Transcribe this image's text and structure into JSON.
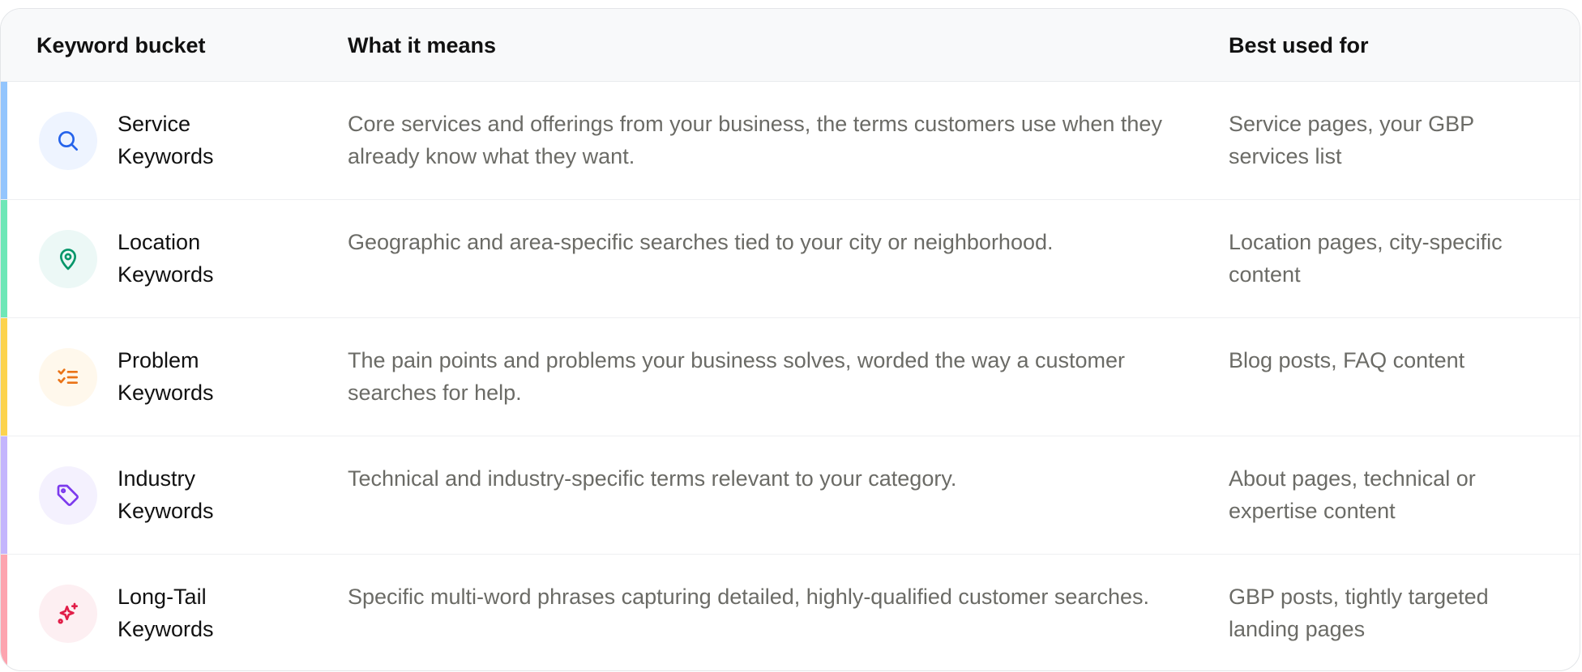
{
  "table": {
    "headers": {
      "bucket": "Keyword bucket",
      "meaning": "What it means",
      "usage": "Best used for"
    },
    "rows": [
      {
        "name": "Service Keywords",
        "meaning": "Core services and offerings from your business, the terms customers use when they already know what they want.",
        "usage": "Service pages, your GBP services list",
        "icon": "search-icon",
        "accent": "#93c5fd",
        "icon_bg": "#eef4ff",
        "icon_color": "#2563eb"
      },
      {
        "name": "Location Keywords",
        "meaning": "Geographic and area-specific searches tied to your city or neighborhood.",
        "usage": "Location pages, city-specific content",
        "icon": "map-pin-icon",
        "accent": "#6ee7b7",
        "icon_bg": "#ecf8f6",
        "icon_color": "#059669"
      },
      {
        "name": "Problem Keywords",
        "meaning": "The pain points and problems your business solves, worded the way a customer searches for help.",
        "usage": "Blog posts, FAQ content",
        "icon": "checklist-icon",
        "accent": "#fcd34d",
        "icon_bg": "#fff8ec",
        "icon_color": "#ea7317"
      },
      {
        "name": "Industry Keywords",
        "meaning": "Technical and industry-specific terms relevant to your category.",
        "usage": "About pages, technical or expertise content",
        "icon": "tag-icon",
        "accent": "#c4b5fd",
        "icon_bg": "#f4f1fe",
        "icon_color": "#7c3aed"
      },
      {
        "name": "Long-Tail Keywords",
        "meaning": "Specific multi-word phrases capturing detailed, highly-qualified customer searches.",
        "usage": "GBP posts, tightly targeted landing pages",
        "icon": "sparkle-icon",
        "accent": "#fda4af",
        "icon_bg": "#fdeff2",
        "icon_color": "#e11d48"
      }
    ]
  }
}
